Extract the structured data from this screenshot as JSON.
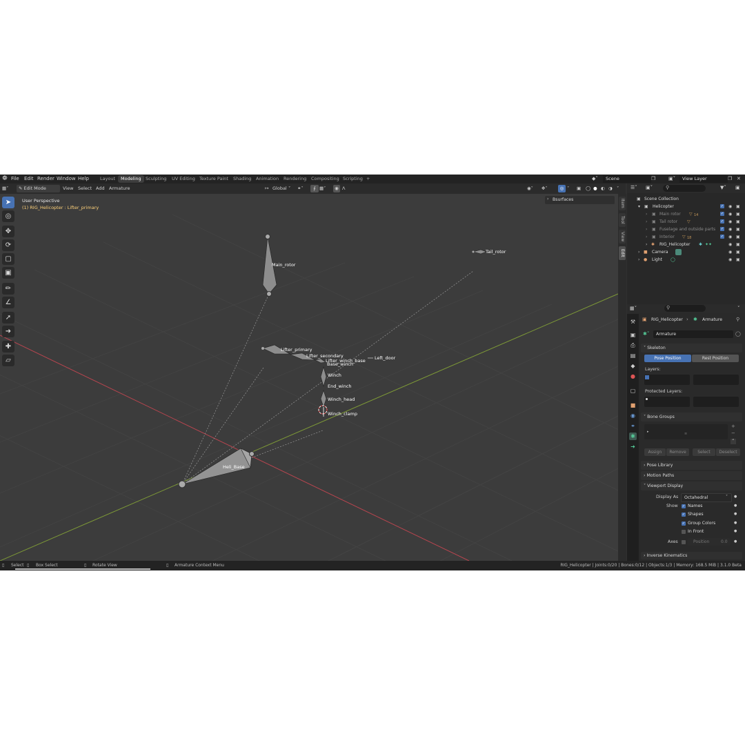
{
  "topbar": {
    "menus": [
      "File",
      "Edit",
      "Render",
      "Window",
      "Help"
    ],
    "workspaces": [
      "Layout",
      "Modeling",
      "Sculpting",
      "UV Editing",
      "Texture Paint",
      "Shading",
      "Animation",
      "Rendering",
      "Compositing",
      "Scripting"
    ],
    "active_workspace": "Modeling",
    "add_tab": "+",
    "scene_name": "Scene",
    "view_layer": "View Layer"
  },
  "viewport_header": {
    "mode": "Edit Mode",
    "menus": [
      "View",
      "Select",
      "Add",
      "Armature"
    ],
    "transform_orientation": "Global"
  },
  "viewport": {
    "perspective_label": "User Perspective",
    "active_object_label": "(1) RIG_Helicopter : Lifter_primary",
    "npanel_header": "Bsurfaces",
    "npanel_tabs": [
      "Item",
      "Tool",
      "View",
      "Edit"
    ],
    "active_npanel_tab": "Edit",
    "bones": [
      "Main_rotor",
      "Tail_rotor",
      "Lifter_primary",
      "Lifter_secondary",
      "Lifter_winch_base",
      "Base_winch",
      "Left_door",
      "Winch",
      "End_winch",
      "Winch_head",
      "Winch_clamp",
      "Heli_Base"
    ],
    "colors": {
      "viewport_bg": "#3c3c3c",
      "grid": "#444444",
      "x_axis": "#b8454f",
      "y_axis": "#7e9a37",
      "active_text": "#ffd27a"
    }
  },
  "outliner": {
    "root": "Scene Collection",
    "items": [
      {
        "name": "Helicopter",
        "depth": 1,
        "dim": false
      },
      {
        "name": "Main rotor",
        "depth": 2,
        "dim": true,
        "badge": "14"
      },
      {
        "name": "Tail rotor",
        "depth": 2,
        "dim": true,
        "badge": ""
      },
      {
        "name": "Fuselage and outside parts",
        "depth": 2,
        "dim": true,
        "badge": ""
      },
      {
        "name": "Interior",
        "depth": 2,
        "dim": true,
        "badge": "18"
      },
      {
        "name": "RIG_Helicopter",
        "depth": 2,
        "dim": false,
        "badge": ""
      },
      {
        "name": "Camera",
        "depth": 1,
        "dim": false,
        "badge": ""
      },
      {
        "name": "Light",
        "depth": 1,
        "dim": false,
        "badge": ""
      }
    ]
  },
  "properties": {
    "breadcrumb_object": "RIG_Helicopter",
    "breadcrumb_data": "Armature",
    "datablock_name": "Armature",
    "skeleton": {
      "title": "Skeleton",
      "pose_position": "Pose Position",
      "rest_position": "Rest Position",
      "layers_label": "Layers:",
      "protected_layers_label": "Protected Layers:"
    },
    "bone_groups": {
      "title": "Bone Groups",
      "assign": "Assign",
      "remove": "Remove",
      "select": "Select",
      "deselect": "Deselect"
    },
    "collapsed_sections": [
      "Pose Library",
      "Motion Paths"
    ],
    "viewport_display": {
      "title": "Viewport Display",
      "display_as_label": "Display As",
      "display_as_value": "Octahedral",
      "show_label": "Show",
      "options": [
        {
          "label": "Names",
          "checked": true
        },
        {
          "label": "Shapes",
          "checked": true
        },
        {
          "label": "Group Colors",
          "checked": true
        },
        {
          "label": "In Front",
          "checked": false
        }
      ],
      "axes_label": "Axes",
      "position_label": "Position",
      "position_value": "0.0"
    },
    "inverse_kinematics": "Inverse Kinematics"
  },
  "statusbar": {
    "select": "Select",
    "box_select": "Box Select",
    "rotate_view": "Rotate View",
    "context_menu": "Armature Context Menu",
    "stats": "RIG_Helicopter | Joints:0/20 | Bones:0/12 | Objects:1/3 | Memory: 168.5 MiB | 3.1.0 Beta"
  }
}
